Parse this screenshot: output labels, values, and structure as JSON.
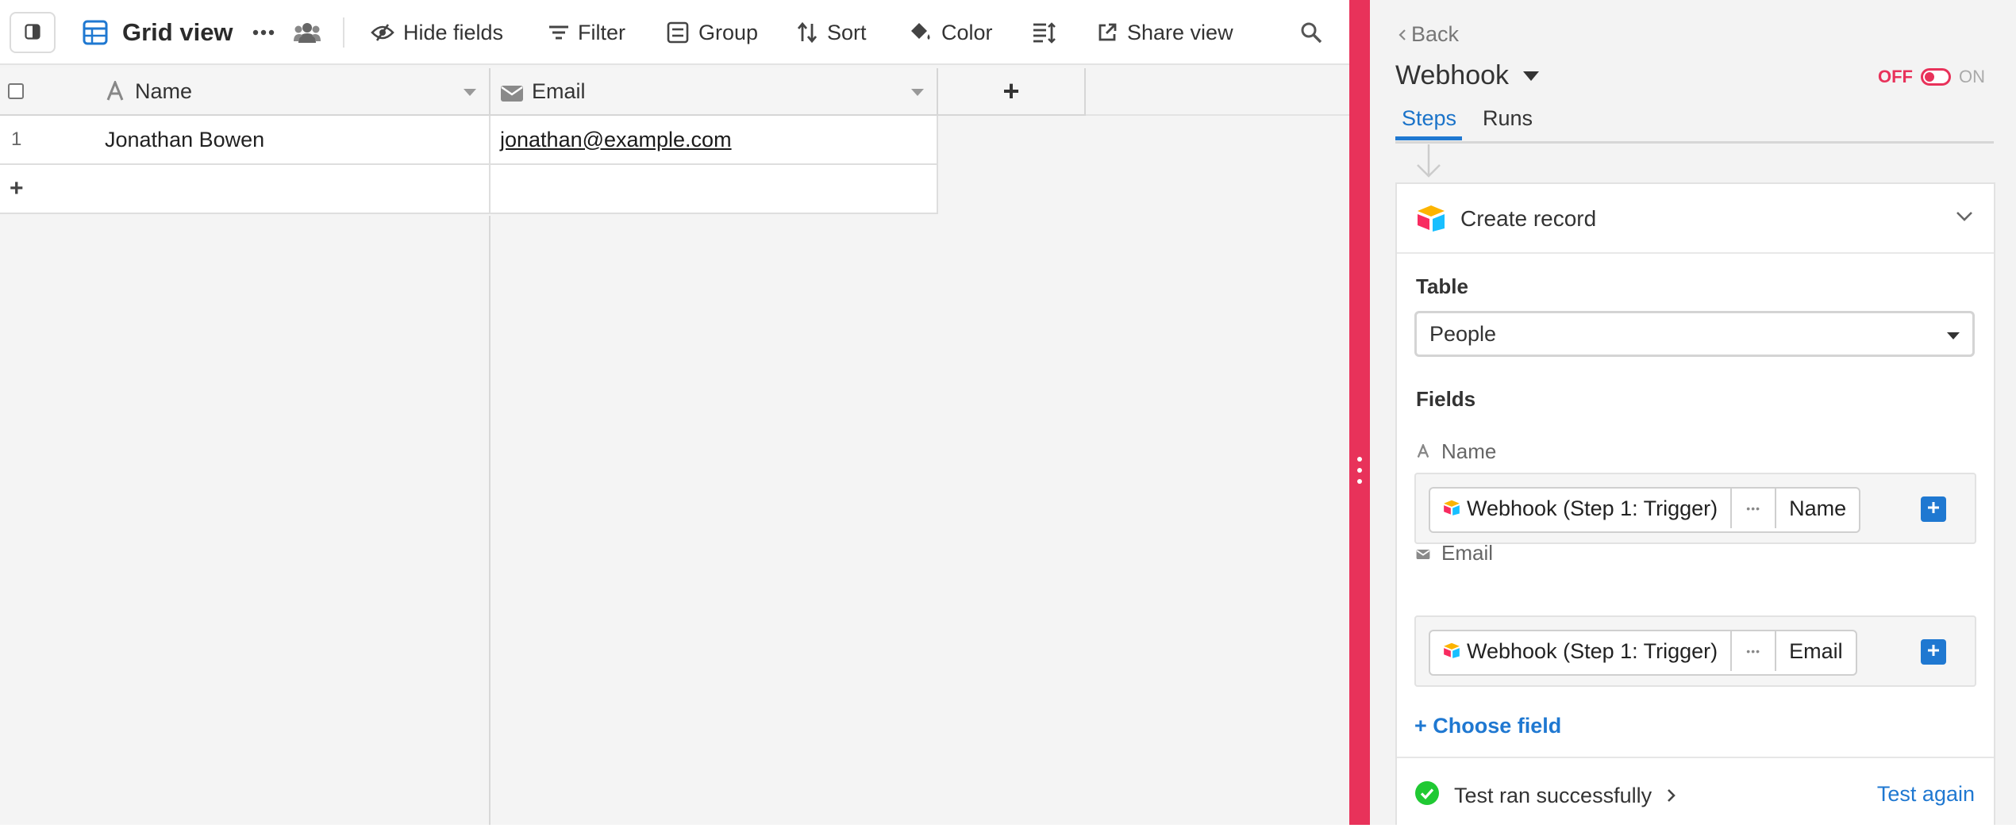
{
  "toolbar": {
    "view_name": "Grid view",
    "hide_fields": "Hide fields",
    "filter": "Filter",
    "group": "Group",
    "sort": "Sort",
    "color": "Color",
    "share_view": "Share view"
  },
  "grid": {
    "columns": [
      {
        "name": "Name",
        "icon": "text-field-icon"
      },
      {
        "name": "Email",
        "icon": "email-field-icon"
      }
    ],
    "add_column": "+",
    "rows": [
      {
        "number": "1",
        "name": "Jonathan Bowen",
        "email": "jonathan@example.com"
      }
    ],
    "add_row": "+"
  },
  "panel": {
    "back": "Back",
    "title": "Webhook",
    "toggle_off": "OFF",
    "toggle_on": "ON",
    "tabs": [
      "Steps",
      "Runs"
    ],
    "step": {
      "title": "Create record",
      "table_label": "Table",
      "table_value": "People",
      "fields_label": "Fields",
      "fields": [
        {
          "label": "Name",
          "source": "Webhook (Step 1: Trigger)",
          "more": "•••",
          "value": "Name"
        },
        {
          "label": "Email",
          "source": "Webhook (Step 1: Trigger)",
          "more": "•••",
          "value": "Email"
        }
      ],
      "choose_field": "+ Choose field",
      "test_status": "Test ran successfully",
      "test_again": "Test again"
    }
  },
  "colors": {
    "accent_blue": "#1f78d1",
    "divider_pink": "#e8325a",
    "success_green": "#20c933"
  }
}
